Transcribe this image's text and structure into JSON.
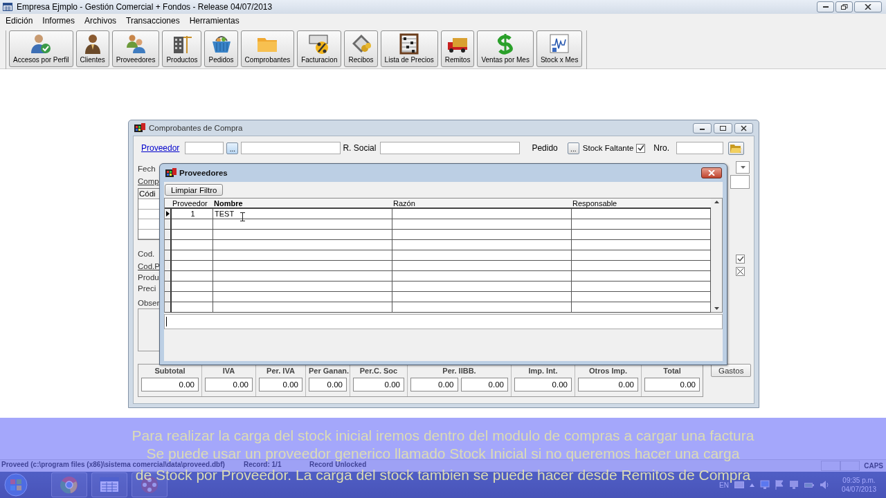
{
  "window": {
    "title": "Empresa Ejmplo - Gestión Comercial + Fondos -  Release 04/07/2013"
  },
  "menu": [
    "Edición",
    "Informes",
    "Archivos",
    "Transacciones",
    "Herramientas"
  ],
  "toolbar": [
    "Accesos por Perfil",
    "Clientes",
    "Proveedores",
    "Productos",
    "Pedidos",
    "Comprobantes",
    "Facturacion",
    "Recibos",
    "Lista de Precios",
    "Remitos",
    "Ventas por Mes",
    "Stock x Mes"
  ],
  "purchase_window": {
    "title": "Comprobantes de Compra",
    "proveedor_link": "Proveedor",
    "browse_button": "...",
    "r_social_label": "R. Social",
    "pedido_label": "Pedido",
    "pedido_button": "...",
    "stock_faltante": {
      "label": "Stock Faltante",
      "checked": true
    },
    "nro_label": "Nro.",
    "side_labels": [
      {
        "kind": "label",
        "text": "Fech"
      },
      {
        "kind": "link",
        "text": "Comp"
      },
      {
        "kind": "table",
        "text": "Códi"
      },
      {
        "kind": "label",
        "text": "Cod."
      },
      {
        "kind": "link",
        "text": "Cod.P"
      },
      {
        "kind": "label",
        "text": "Produ"
      },
      {
        "kind": "label",
        "text": "Preci"
      },
      {
        "kind": "label",
        "text": "Obser"
      }
    ],
    "totals": [
      {
        "label": "Subtotal",
        "values": [
          "0.00"
        ]
      },
      {
        "label": "IVA",
        "values": [
          "0.00"
        ]
      },
      {
        "label": "Per. IVA",
        "values": [
          "0.00"
        ]
      },
      {
        "label": "Per Ganan.",
        "values": [
          "0.00"
        ]
      },
      {
        "label": "Per.C. Soc",
        "values": [
          "0.00"
        ]
      },
      {
        "label": "Per. IIBB.",
        "values": [
          "0.00",
          "0.00"
        ]
      },
      {
        "label": "Imp. Int.",
        "values": [
          "0.00"
        ]
      },
      {
        "label": "Otros Imp.",
        "values": [
          "0.00"
        ]
      },
      {
        "label": "Total",
        "values": [
          "0.00"
        ]
      }
    ],
    "gastos_button": "Gastos"
  },
  "dialog": {
    "title": "Proveedores",
    "clear_filter_button": "Limpiar Filtro",
    "columns": [
      "Proveedor",
      "Nombre",
      "Razón",
      "Responsable"
    ],
    "rows": [
      {
        "proveedor": "1",
        "nombre": "TEST",
        "selected": true
      }
    ]
  },
  "status_bar": [
    "Proveed (c:\\program files (x86)\\sistema comercial\\data\\proveed.dbf)",
    "Record: 1/1",
    "Record Unlocked",
    "CAPS"
  ],
  "taskbar": {
    "language": "EN",
    "time": "09:35 p.m.",
    "date": "04/07/2013"
  },
  "caption": [
    "Para realizar la carga del stock inicial iremos dentro del modulo de compras a cargar una factura",
    "Se puede usar un proveedor generico llamado Stock Inicial si no queremos hacer una carga",
    "de Stock por Proveedor. La carga del stock tambien se puede hacer desde Remitos de Compra"
  ]
}
